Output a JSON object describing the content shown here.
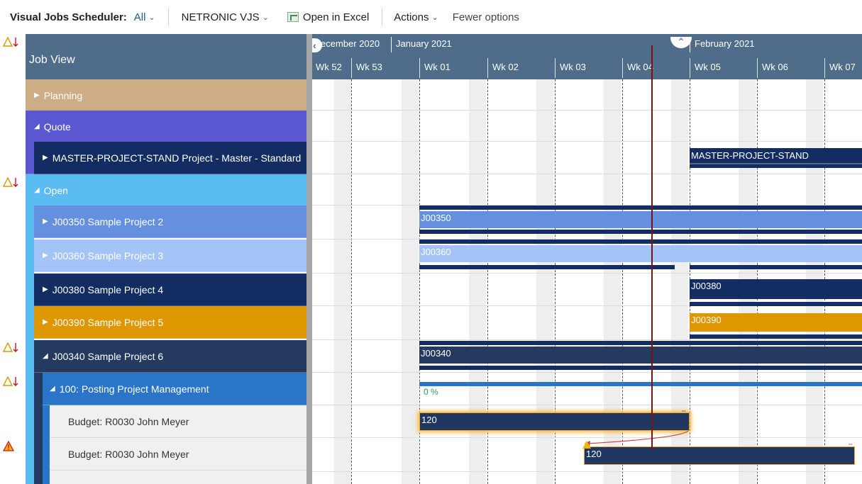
{
  "toolbar": {
    "title": "Visual Jobs Scheduler:",
    "filter": "All",
    "netronic": "NETRONIC VJS",
    "open_excel": "Open in Excel",
    "actions": "Actions",
    "fewer": "Fewer options"
  },
  "left": {
    "header": "Job View",
    "rows": [
      {
        "label": "Planning"
      },
      {
        "label": "Quote"
      },
      {
        "label": "MASTER-PROJECT-STAND Project - Master - Standard"
      },
      {
        "label": "Open"
      },
      {
        "label": "J00350 Sample Project 2"
      },
      {
        "label": "J00360 Sample Project 3"
      },
      {
        "label": "J00380 Sample Project 4"
      },
      {
        "label": "J00390 Sample Project 5"
      },
      {
        "label": "J00340 Sample Project 6"
      },
      {
        "label": "100: Posting Project Management"
      },
      {
        "label": "Budget: R0030 John Meyer"
      },
      {
        "label": "Budget: R0030 John Meyer"
      }
    ]
  },
  "timeline": {
    "months": [
      "ecember 2020",
      "January 2021",
      "February 2021"
    ],
    "weeks": [
      "Wk 52",
      "Wk 53",
      "Wk 01",
      "Wk 02",
      "Wk 03",
      "Wk 04",
      "Wk 05",
      "Wk 06",
      "Wk 07"
    ]
  },
  "bars": {
    "master": "MASTER-PROJECT-STAND",
    "j350": "J00350",
    "j360": "J00360",
    "j380": "J00380",
    "j390": "J00390",
    "j340": "J00340",
    "progress": "0 %",
    "budget1": "120",
    "budget2": "120"
  },
  "colors": {
    "header": "#4f6d8a",
    "planning": "#cdac86",
    "quote": "#5b57d1",
    "master": "#132d63",
    "open": "#5bbcf2",
    "j350": "#6590e0",
    "j360": "#a4c4f8",
    "j380": "#132d63",
    "j390": "#de9700",
    "j340": "#253a60",
    "task": "#2a75c8",
    "budget": "#f0f0f0",
    "today": "#7a1214"
  }
}
